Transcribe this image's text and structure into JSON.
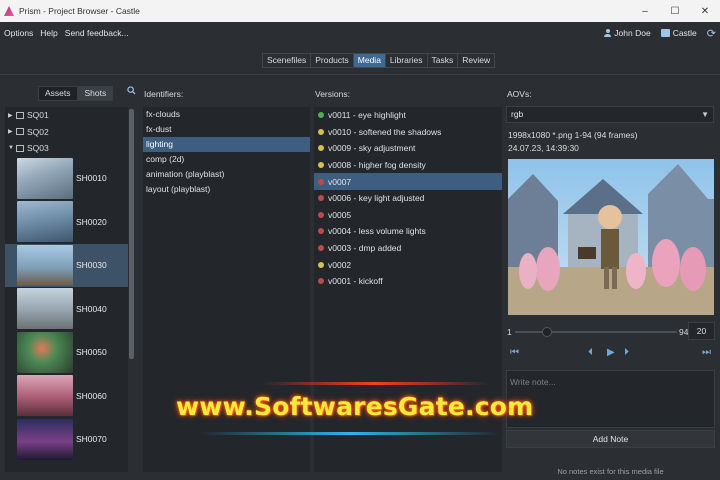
{
  "window": {
    "title": "Prism - Project Browser - Castle",
    "controls": [
      "–",
      "☐",
      "✕"
    ]
  },
  "menu": {
    "items": [
      "Options",
      "Help",
      "Send feedback..."
    ],
    "user": "John Doe",
    "project": "Castle"
  },
  "tabs": [
    "Scenefiles",
    "Products",
    "Media",
    "Libraries",
    "Tasks",
    "Review"
  ],
  "active_tab": "Media",
  "entities": {
    "toggle": [
      "Assets",
      "Shots"
    ],
    "active_toggle": "Shots",
    "sequences": [
      {
        "label": "SQ01",
        "arrow": "▶"
      },
      {
        "label": "SQ02",
        "arrow": "▶"
      },
      {
        "label": "SQ03",
        "arrow": "▼"
      }
    ],
    "shots": [
      {
        "label": "SH0010"
      },
      {
        "label": "SH0020"
      },
      {
        "label": "SH0030"
      },
      {
        "label": "SH0040"
      },
      {
        "label": "SH0050"
      },
      {
        "label": "SH0060"
      },
      {
        "label": "SH0070"
      }
    ],
    "selected_shot": "SH0030"
  },
  "identifiers": {
    "header": "Identifiers:",
    "items": [
      "fx-clouds",
      "fx-dust",
      "lighting",
      "comp (2d)",
      "animation (playblast)",
      "layout (playblast)"
    ],
    "selected": "lighting"
  },
  "versions": {
    "header": "Versions:",
    "items": [
      {
        "label": "v0011 - eye highlight",
        "status": "green"
      },
      {
        "label": "v0010 - softened the shadows",
        "status": "yellow"
      },
      {
        "label": "v0009 - sky adjustment",
        "status": "yellow"
      },
      {
        "label": "v0008 - higher fog density",
        "status": "yellow"
      },
      {
        "label": "v0007",
        "status": "red"
      },
      {
        "label": "v0006 - key light adjusted",
        "status": "red"
      },
      {
        "label": "v0005",
        "status": "red"
      },
      {
        "label": "v0004 - less volume lights",
        "status": "red"
      },
      {
        "label": "v0003 - dmp added",
        "status": "red"
      },
      {
        "label": "v0002",
        "status": "yellow"
      },
      {
        "label": "v0001 - kickoff",
        "status": "red"
      }
    ],
    "selected": "v0007",
    "status_colors": {
      "green": "#4caf50",
      "yellow": "#d6c24a",
      "red": "#b94b4b"
    }
  },
  "aovs": {
    "header": "AOVs:",
    "selected": "rgb",
    "info_line1": "1998x1080   *.png   1-94 (94 frames)",
    "info_line2": "24.07.23,  14:39:30"
  },
  "player": {
    "frame_start": "1",
    "frame_end": "94",
    "current_frame": "20",
    "current_fraction": 0.2
  },
  "notes": {
    "placeholder": "Write note...",
    "add_label": "Add Note",
    "empty_text": "No notes exist for this media file"
  },
  "watermark": "www.SoftwaresGate.com",
  "colors": {
    "accent": "#3d6a93",
    "selection": "#3d5e80",
    "background": "#2b2f33",
    "panel": "#23272b"
  }
}
